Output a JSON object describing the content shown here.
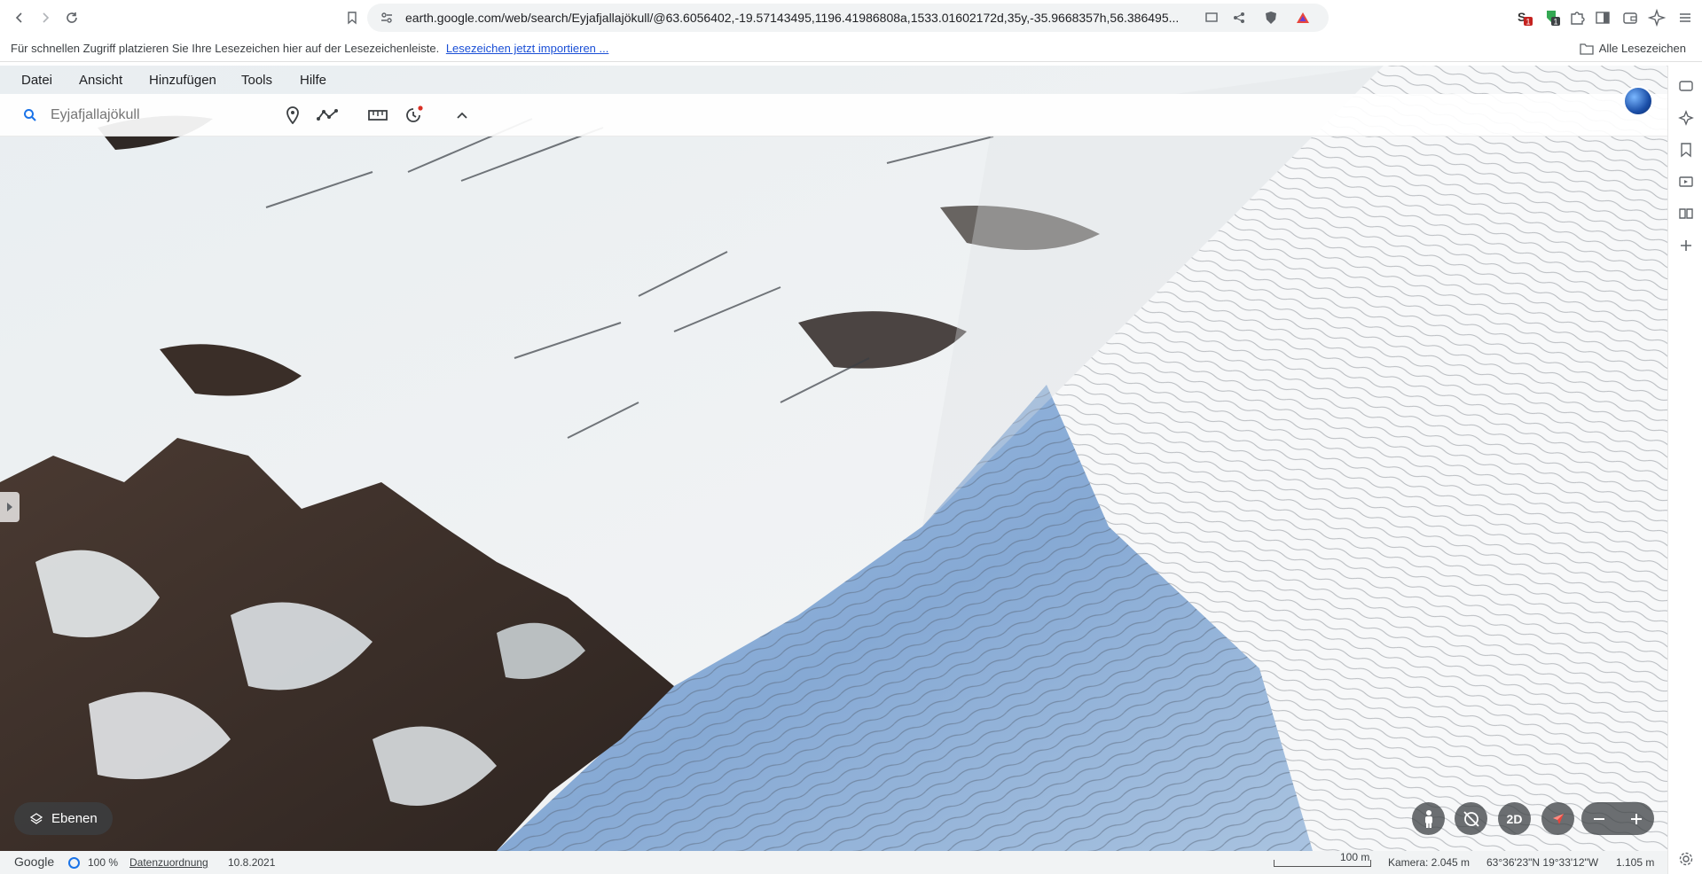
{
  "browser": {
    "url": "earth.google.com/web/search/Eyjafjallajökull/@63.6056402,-19.57143495,1196.41986808a,1533.01602172d,35y,-35.9668357h,56.386495...",
    "bookmarks_message": "Für schnellen Zugriff platzieren Sie Ihre Lesezeichen hier auf der Lesezeichenleiste.",
    "bookmarks_import_link": "Lesezeichen jetzt importieren ...",
    "all_bookmarks": "Alle Lesezeichen",
    "ext_badge_1": "1",
    "ext_badge_2": "1"
  },
  "app": {
    "menu": [
      "Datei",
      "Ansicht",
      "Hinzufügen",
      "Tools",
      "Hilfe"
    ],
    "search_placeholder": "Eyjafjallajökull",
    "layers_label": "Ebenen",
    "view_2d_label": "2D"
  },
  "status": {
    "brand": "Google",
    "load_percent": "100 %",
    "data_attribution": "Datenzuordnung",
    "imagery_date": "10.8.2021",
    "scale_label": "100 m",
    "camera": "Kamera: 2.045 m",
    "coordinates": "63°36'23\"N 19°33'12\"W",
    "elevation": "1.105 m"
  },
  "colors": {
    "accent_blue": "#1a73e8",
    "snow": "#eef1f3",
    "rock": "#3a2e28",
    "shadow_blue": "#8fb2dc"
  }
}
